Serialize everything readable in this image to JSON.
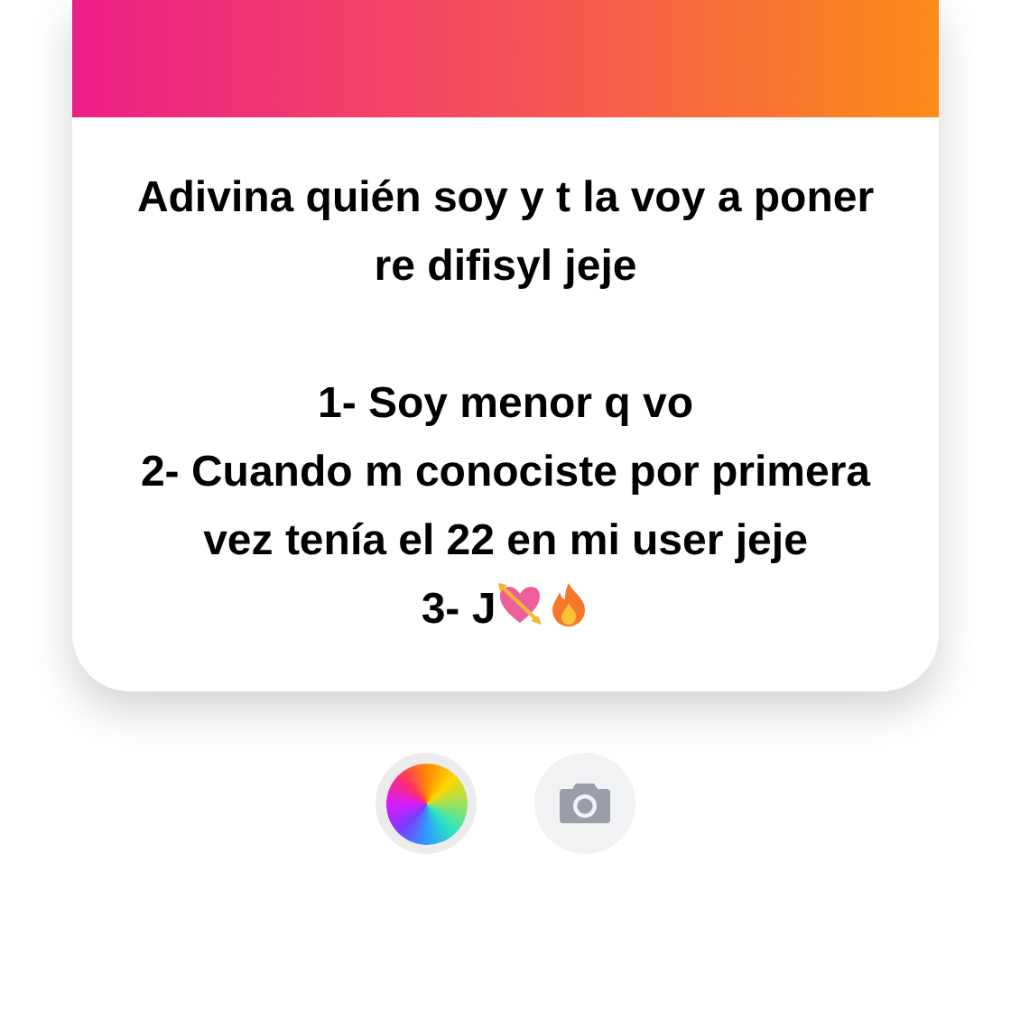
{
  "question": {
    "intro": "Adivina quién soy y t la voy a poner re difisyl jeje",
    "items": [
      {
        "text": "1- Soy menor q vo",
        "kind": "plain"
      },
      {
        "text": "2- Cuando m conociste por primera vez tenía el 22 en mi user jeje",
        "kind": "plain"
      },
      {
        "text": "3- J",
        "kind": "emoji"
      }
    ]
  },
  "tools": [
    {
      "kind": "color"
    },
    {
      "kind": "camera"
    }
  ]
}
